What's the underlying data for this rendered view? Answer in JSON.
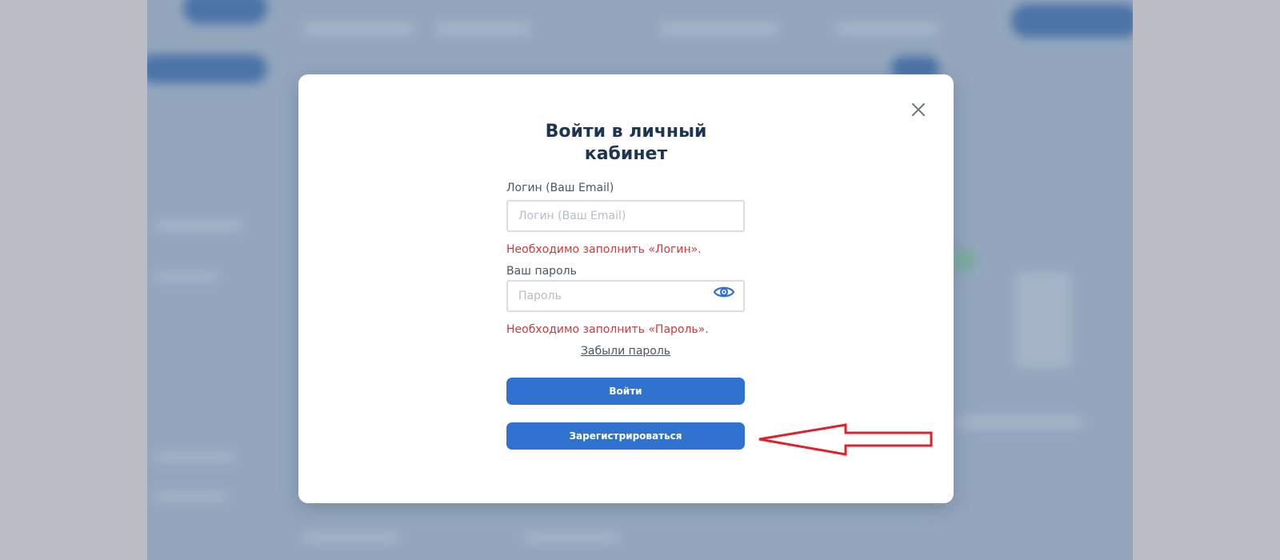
{
  "modal": {
    "title": "Войти в личный кабинет",
    "login": {
      "label": "Логин (Ваш Email)",
      "placeholder": "Логин (Ваш Email)",
      "error": "Необходимо заполнить «Логин»."
    },
    "password": {
      "label": "Ваш пароль",
      "placeholder": "Пароль",
      "error": "Необходимо заполнить «Пароль»."
    },
    "forgot_link": "Забыли пароль",
    "login_button": "Войти",
    "register_button": "Зарегистрироваться"
  },
  "icons": {
    "close": "close-icon",
    "toggle_password": "eye-icon",
    "annotation": "red-arrow-annotation"
  },
  "colors": {
    "primary_button": "#2f72cf",
    "title": "#1d3452",
    "error": "#d2383a",
    "annotation_arrow": "#e0202a",
    "overlay": "#93a6bd"
  }
}
